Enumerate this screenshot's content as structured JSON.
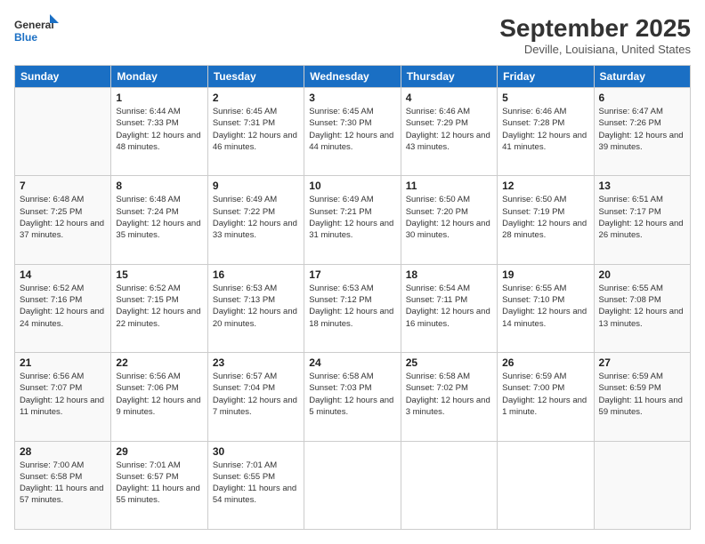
{
  "logo": {
    "line1": "General",
    "line2": "Blue"
  },
  "title": "September 2025",
  "location": "Deville, Louisiana, United States",
  "weekdays": [
    "Sunday",
    "Monday",
    "Tuesday",
    "Wednesday",
    "Thursday",
    "Friday",
    "Saturday"
  ],
  "weeks": [
    [
      {
        "day": "",
        "sunrise": "",
        "sunset": "",
        "daylight": ""
      },
      {
        "day": "1",
        "sunrise": "Sunrise: 6:44 AM",
        "sunset": "Sunset: 7:33 PM",
        "daylight": "Daylight: 12 hours and 48 minutes."
      },
      {
        "day": "2",
        "sunrise": "Sunrise: 6:45 AM",
        "sunset": "Sunset: 7:31 PM",
        "daylight": "Daylight: 12 hours and 46 minutes."
      },
      {
        "day": "3",
        "sunrise": "Sunrise: 6:45 AM",
        "sunset": "Sunset: 7:30 PM",
        "daylight": "Daylight: 12 hours and 44 minutes."
      },
      {
        "day": "4",
        "sunrise": "Sunrise: 6:46 AM",
        "sunset": "Sunset: 7:29 PM",
        "daylight": "Daylight: 12 hours and 43 minutes."
      },
      {
        "day": "5",
        "sunrise": "Sunrise: 6:46 AM",
        "sunset": "Sunset: 7:28 PM",
        "daylight": "Daylight: 12 hours and 41 minutes."
      },
      {
        "day": "6",
        "sunrise": "Sunrise: 6:47 AM",
        "sunset": "Sunset: 7:26 PM",
        "daylight": "Daylight: 12 hours and 39 minutes."
      }
    ],
    [
      {
        "day": "7",
        "sunrise": "Sunrise: 6:48 AM",
        "sunset": "Sunset: 7:25 PM",
        "daylight": "Daylight: 12 hours and 37 minutes."
      },
      {
        "day": "8",
        "sunrise": "Sunrise: 6:48 AM",
        "sunset": "Sunset: 7:24 PM",
        "daylight": "Daylight: 12 hours and 35 minutes."
      },
      {
        "day": "9",
        "sunrise": "Sunrise: 6:49 AM",
        "sunset": "Sunset: 7:22 PM",
        "daylight": "Daylight: 12 hours and 33 minutes."
      },
      {
        "day": "10",
        "sunrise": "Sunrise: 6:49 AM",
        "sunset": "Sunset: 7:21 PM",
        "daylight": "Daylight: 12 hours and 31 minutes."
      },
      {
        "day": "11",
        "sunrise": "Sunrise: 6:50 AM",
        "sunset": "Sunset: 7:20 PM",
        "daylight": "Daylight: 12 hours and 30 minutes."
      },
      {
        "day": "12",
        "sunrise": "Sunrise: 6:50 AM",
        "sunset": "Sunset: 7:19 PM",
        "daylight": "Daylight: 12 hours and 28 minutes."
      },
      {
        "day": "13",
        "sunrise": "Sunrise: 6:51 AM",
        "sunset": "Sunset: 7:17 PM",
        "daylight": "Daylight: 12 hours and 26 minutes."
      }
    ],
    [
      {
        "day": "14",
        "sunrise": "Sunrise: 6:52 AM",
        "sunset": "Sunset: 7:16 PM",
        "daylight": "Daylight: 12 hours and 24 minutes."
      },
      {
        "day": "15",
        "sunrise": "Sunrise: 6:52 AM",
        "sunset": "Sunset: 7:15 PM",
        "daylight": "Daylight: 12 hours and 22 minutes."
      },
      {
        "day": "16",
        "sunrise": "Sunrise: 6:53 AM",
        "sunset": "Sunset: 7:13 PM",
        "daylight": "Daylight: 12 hours and 20 minutes."
      },
      {
        "day": "17",
        "sunrise": "Sunrise: 6:53 AM",
        "sunset": "Sunset: 7:12 PM",
        "daylight": "Daylight: 12 hours and 18 minutes."
      },
      {
        "day": "18",
        "sunrise": "Sunrise: 6:54 AM",
        "sunset": "Sunset: 7:11 PM",
        "daylight": "Daylight: 12 hours and 16 minutes."
      },
      {
        "day": "19",
        "sunrise": "Sunrise: 6:55 AM",
        "sunset": "Sunset: 7:10 PM",
        "daylight": "Daylight: 12 hours and 14 minutes."
      },
      {
        "day": "20",
        "sunrise": "Sunrise: 6:55 AM",
        "sunset": "Sunset: 7:08 PM",
        "daylight": "Daylight: 12 hours and 13 minutes."
      }
    ],
    [
      {
        "day": "21",
        "sunrise": "Sunrise: 6:56 AM",
        "sunset": "Sunset: 7:07 PM",
        "daylight": "Daylight: 12 hours and 11 minutes."
      },
      {
        "day": "22",
        "sunrise": "Sunrise: 6:56 AM",
        "sunset": "Sunset: 7:06 PM",
        "daylight": "Daylight: 12 hours and 9 minutes."
      },
      {
        "day": "23",
        "sunrise": "Sunrise: 6:57 AM",
        "sunset": "Sunset: 7:04 PM",
        "daylight": "Daylight: 12 hours and 7 minutes."
      },
      {
        "day": "24",
        "sunrise": "Sunrise: 6:58 AM",
        "sunset": "Sunset: 7:03 PM",
        "daylight": "Daylight: 12 hours and 5 minutes."
      },
      {
        "day": "25",
        "sunrise": "Sunrise: 6:58 AM",
        "sunset": "Sunset: 7:02 PM",
        "daylight": "Daylight: 12 hours and 3 minutes."
      },
      {
        "day": "26",
        "sunrise": "Sunrise: 6:59 AM",
        "sunset": "Sunset: 7:00 PM",
        "daylight": "Daylight: 12 hours and 1 minute."
      },
      {
        "day": "27",
        "sunrise": "Sunrise: 6:59 AM",
        "sunset": "Sunset: 6:59 PM",
        "daylight": "Daylight: 11 hours and 59 minutes."
      }
    ],
    [
      {
        "day": "28",
        "sunrise": "Sunrise: 7:00 AM",
        "sunset": "Sunset: 6:58 PM",
        "daylight": "Daylight: 11 hours and 57 minutes."
      },
      {
        "day": "29",
        "sunrise": "Sunrise: 7:01 AM",
        "sunset": "Sunset: 6:57 PM",
        "daylight": "Daylight: 11 hours and 55 minutes."
      },
      {
        "day": "30",
        "sunrise": "Sunrise: 7:01 AM",
        "sunset": "Sunset: 6:55 PM",
        "daylight": "Daylight: 11 hours and 54 minutes."
      },
      {
        "day": "",
        "sunrise": "",
        "sunset": "",
        "daylight": ""
      },
      {
        "day": "",
        "sunrise": "",
        "sunset": "",
        "daylight": ""
      },
      {
        "day": "",
        "sunrise": "",
        "sunset": "",
        "daylight": ""
      },
      {
        "day": "",
        "sunrise": "",
        "sunset": "",
        "daylight": ""
      }
    ]
  ]
}
